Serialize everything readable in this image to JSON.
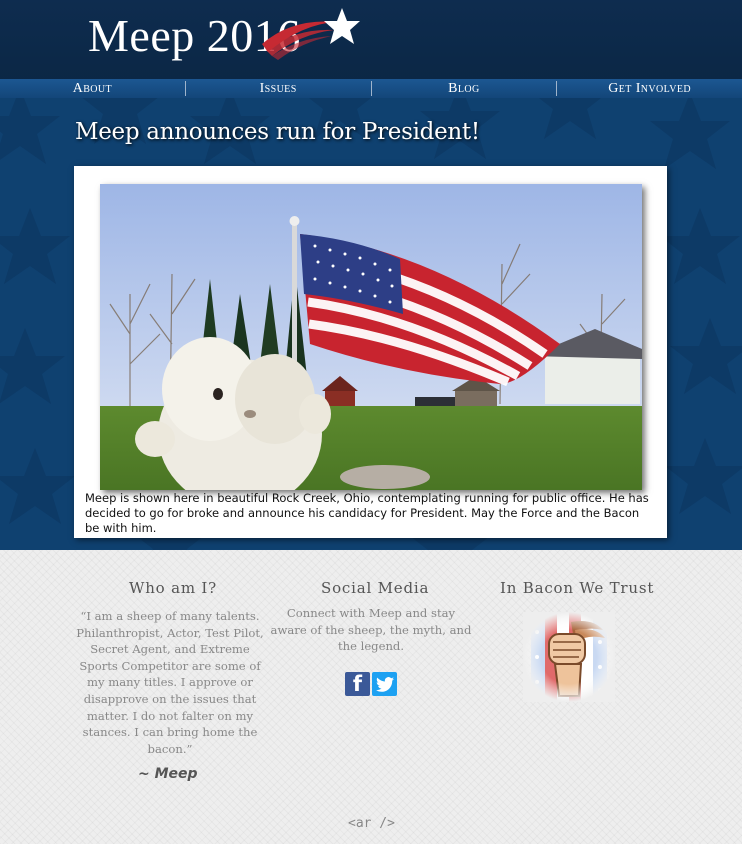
{
  "site": {
    "title": "Meep 2016"
  },
  "nav": {
    "items": [
      {
        "label": "About"
      },
      {
        "label": "Issues"
      },
      {
        "label": "Blog"
      },
      {
        "label": "Get Involved"
      }
    ]
  },
  "post": {
    "title": "Meep announces run for President!",
    "caption": "Meep is shown here in beautiful Rock Creek, Ohio, contemplating running for public office. He has decided to go for broke and announce his candidacy for President. May the Force and the Bacon be with him."
  },
  "footer": {
    "about": {
      "title": "Who am I?",
      "quote": "“I am a sheep of many talents. Philanthropist, Actor, Test Pilot, Secret Agent, and Extreme Sports Competitor are some of my many titles. I approve or disapprove on the issues that matter. I do not falter on my stances. I can bring home the bacon.”",
      "signature": "~ Meep"
    },
    "social": {
      "title": "Social Media",
      "text": "Connect with Meep and stay aware of the sheep, the myth, and the legend.",
      "facebook_glyph": "f"
    },
    "bacon": {
      "title": "In Bacon We Trust"
    },
    "credit": "<ar />"
  },
  "colors": {
    "header_bg": "#0e2c4f",
    "nav_bg": "#1c5792",
    "main_bg": "#0f4170",
    "footer_bg": "#eeeeee",
    "logo_accent_red": "#c62a33"
  },
  "icons": {
    "logo_star": "star-swoosh-icon",
    "facebook": "facebook-icon",
    "twitter": "twitter-icon",
    "badge": "bacon-fist-icon"
  }
}
